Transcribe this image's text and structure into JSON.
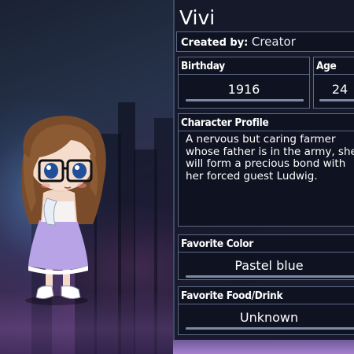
{
  "character": {
    "name": "Vivi",
    "created_by_label": "Created by:",
    "created_by": "Creator"
  },
  "fields": {
    "birthday_label": "Birthday",
    "birthday": "1916",
    "age_label": "Age",
    "age": "24",
    "profile_label": "Character Profile",
    "profile": "A nervous but caring farmer whose father is in the army, she will form a precious bond with her forced guest Ludwig.",
    "color_label": "Favorite Color",
    "color": "Pastel blue",
    "food_label": "Favorite Food/Drink",
    "food": "Unknown"
  },
  "colors": {
    "panel_bg": "#141828",
    "panel_border": "#5d6a86",
    "text": "#ffffff",
    "dress": "#b9a6e6",
    "hair": "#8a5a34"
  }
}
